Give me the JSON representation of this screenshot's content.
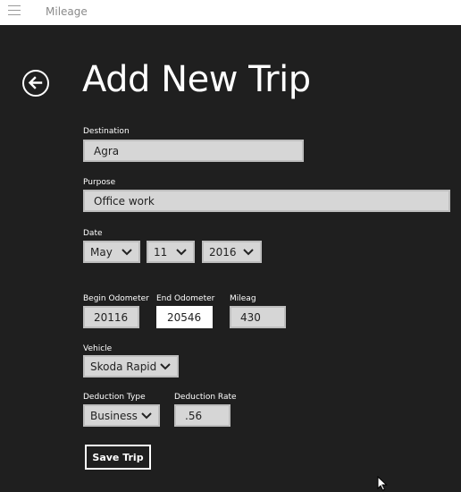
{
  "app": {
    "title": "Mileage"
  },
  "page": {
    "title": "Add New Trip"
  },
  "form": {
    "destination": {
      "label": "Destination",
      "value": "Agra"
    },
    "purpose": {
      "label": "Purpose",
      "value": "Office work"
    },
    "date": {
      "label": "Date",
      "month": "May",
      "day": "11",
      "year": "2016"
    },
    "begin_odometer": {
      "label": "Begin Odometer",
      "value": "20116"
    },
    "end_odometer": {
      "label": "End Odometer",
      "value": "20546"
    },
    "mileage": {
      "label": "Mileag",
      "value": "430"
    },
    "vehicle": {
      "label": "Vehicle",
      "value": "Skoda Rapid"
    },
    "deduction_type": {
      "label": "Deduction Type",
      "value": "Business"
    },
    "deduction_rate": {
      "label": "Deduction Rate",
      "value": ".56"
    },
    "save_label": "Save Trip"
  },
  "icons": {
    "menu": "hamburger-icon",
    "back": "back-arrow-icon",
    "dropdown": "chevron-down-icon",
    "pointer": "mouse-cursor-icon"
  },
  "colors": {
    "background": "#1f1f1f",
    "titlebar": "#ffffff",
    "field": "#d6d6d6",
    "text": "#ffffff"
  }
}
